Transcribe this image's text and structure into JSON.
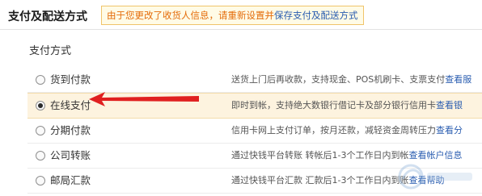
{
  "header": {
    "title": "支付及配送方式",
    "notice_text": "由于您更改了收货人信息，请重新设置并",
    "notice_link": "保存支付及配送方式"
  },
  "section": {
    "title": "支付方式"
  },
  "payment_options": [
    {
      "label": "货到付款",
      "desc": "送货上门后再收款，支持现金、POS机刷卡、支票支付",
      "link": "查看服",
      "selected": false
    },
    {
      "label": "在线支付",
      "desc": "即时到帐，支持绝大数银行借记卡及部分银行信用卡",
      "link": "查看银",
      "selected": true
    },
    {
      "label": "分期付款",
      "desc": "信用卡网上支付订单，按月还款，减轻资金周转压力",
      "link": "查看分",
      "selected": false
    },
    {
      "label": "公司转账",
      "desc": "通过快钱平台转账 转帐后1-3个工作日内到帐",
      "link": "查看帐户信息",
      "selected": false
    },
    {
      "label": "邮局汇款",
      "desc": "通过快钱平台汇款 汇款后1-3个工作日内到账",
      "link": "查看帮助",
      "selected": false
    }
  ],
  "colors": {
    "arrow": "#e02020",
    "notice_text": "#e46c0a",
    "link": "#2a5db0",
    "selected_row_bg": "#fdf3df"
  }
}
